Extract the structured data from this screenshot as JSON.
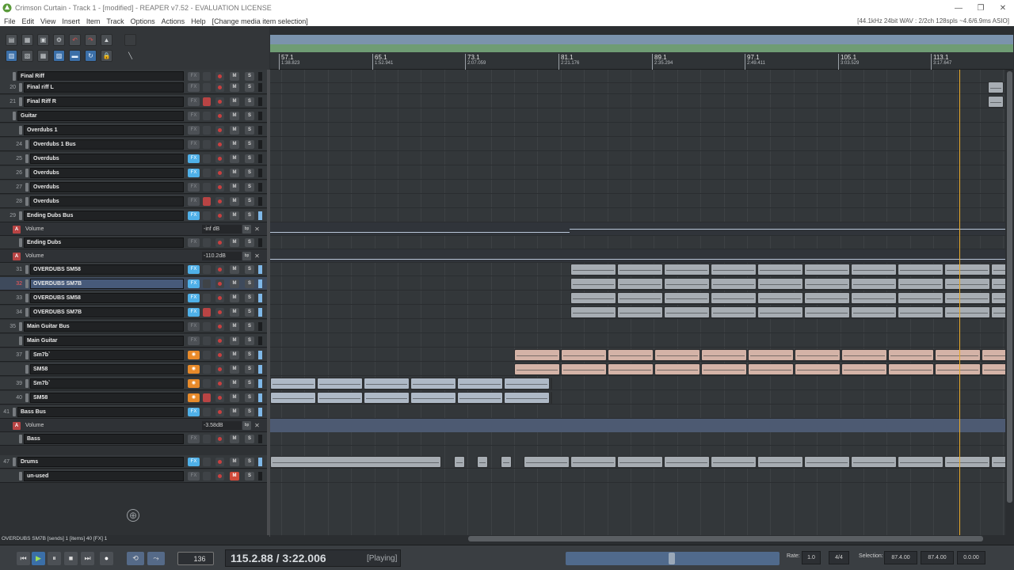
{
  "window": {
    "title": "Crimson Curtain - Track 1 - [modified] - REAPER v7.52 - EVALUATION LICENSE",
    "audio_status": "[44.1kHz 24bit WAV : 2/2ch 128spls ~4.6/6.9ms ASIO]"
  },
  "menu": {
    "items": [
      "File",
      "Edit",
      "View",
      "Insert",
      "Item",
      "Track",
      "Options",
      "Actions",
      "Help",
      "[Change media item selection]"
    ]
  },
  "ruler": {
    "marks": [
      {
        "bar": "57.1",
        "time": "1:38.823"
      },
      {
        "bar": "65.1",
        "time": "1:52.941"
      },
      {
        "bar": "73.1",
        "time": "2:07.059"
      },
      {
        "bar": "81.1",
        "time": "2:21.176"
      },
      {
        "bar": "89.1",
        "time": "2:35.294"
      },
      {
        "bar": "97.1",
        "time": "2:49.411"
      },
      {
        "bar": "105.1",
        "time": "3:03.529"
      },
      {
        "bar": "113.1",
        "time": "3:17.647"
      }
    ]
  },
  "tracks": {
    "fx_label": "FX",
    "m_label": "M",
    "s_label": "S",
    "rows": [
      {
        "num": "",
        "name": "Final Riff"
      },
      {
        "num": "20",
        "name": "Final riff L"
      },
      {
        "num": "21",
        "name": "Final Riff R"
      },
      {
        "num": "",
        "name": "Guitar"
      },
      {
        "num": "",
        "name": "Overdubs 1"
      },
      {
        "num": "24",
        "name": "Overdubs 1 Bus"
      },
      {
        "num": "25",
        "name": "Overdubs"
      },
      {
        "num": "26",
        "name": "Overdubs"
      },
      {
        "num": "27",
        "name": "Overdubs"
      },
      {
        "num": "28",
        "name": "Overdubs"
      },
      {
        "num": "29",
        "name": "Ending Dubs Bus"
      },
      {
        "num": "",
        "name": "Ending Dubs"
      },
      {
        "num": "31",
        "name": "OVERDUBS SM58"
      },
      {
        "num": "32",
        "name": "OVERDUBS SM7B"
      },
      {
        "num": "33",
        "name": "OVERDUBS SM58"
      },
      {
        "num": "34",
        "name": "OVERDUBS SM7B"
      },
      {
        "num": "35",
        "name": "Main Guitar Bus"
      },
      {
        "num": "",
        "name": "Main Guitar"
      },
      {
        "num": "37",
        "name": "Sm7b`"
      },
      {
        "num": "",
        "name": "SM58"
      },
      {
        "num": "39",
        "name": "Sm7b`"
      },
      {
        "num": "40",
        "name": "SM58"
      },
      {
        "num": "41",
        "name": "Bass Bus"
      },
      {
        "num": "",
        "name": "Bass"
      },
      {
        "num": "47",
        "name": "Drums"
      },
      {
        "num": "",
        "name": "un-used"
      }
    ],
    "envelopes": [
      {
        "badge": "A",
        "name": "Volume",
        "value": "-inf dB",
        "bypass": "bp"
      },
      {
        "badge": "A",
        "name": "Volume",
        "value": "-110.2dB",
        "bypass": "bp"
      },
      {
        "badge": "A",
        "name": "Volume",
        "value": "-3.58dB",
        "bypass": "bp"
      }
    ]
  },
  "status_line": "OVERDUBS SM7B [sends] 1 [items] 40 [FX] 1",
  "transport": {
    "time": "115.2.88 / 3:22.006",
    "state": "[Playing]",
    "rate_label": "Rate:",
    "rate_value": "1.0",
    "time_sig": "4/4",
    "selection_label": "Selection:",
    "selection_start": "87.4.00",
    "selection_end": "87.4.00",
    "selection_length": "0.0.00",
    "bpm_box": "136"
  },
  "add_track_symbol": "⊕"
}
